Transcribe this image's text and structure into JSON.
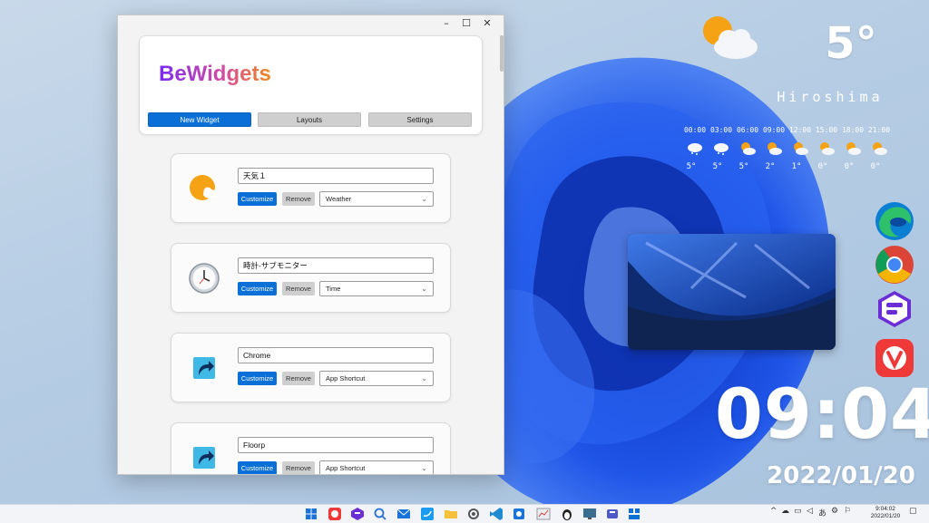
{
  "app": {
    "brand": "BeWidgets",
    "nav": {
      "new_widget": "New Widget",
      "layouts": "Layouts",
      "settings": "Settings"
    },
    "window_controls": {
      "minimize": "–",
      "maximize": "☐",
      "close": "✕"
    },
    "widgets": [
      {
        "name": "天気１",
        "customize": "Customize",
        "remove": "Remove",
        "type": "Weather",
        "icon": "weather-sun-cloud-icon"
      },
      {
        "name": "時計-サブモニター",
        "customize": "Customize",
        "remove": "Remove",
        "type": "Time",
        "icon": "clock-icon"
      },
      {
        "name": "Chrome",
        "customize": "Customize",
        "remove": "Remove",
        "type": "App Shortcut",
        "icon": "shortcut-arrow-icon"
      },
      {
        "name": "Floorp",
        "customize": "Customize",
        "remove": "Remove",
        "type": "App Shortcut",
        "icon": "shortcut-arrow-icon"
      }
    ]
  },
  "weather": {
    "temp": "5°",
    "city": "Hiroshima",
    "forecast": [
      {
        "time": "00:00",
        "temp": "5°",
        "icon": "cloud-snow-icon"
      },
      {
        "time": "03:00",
        "temp": "5°",
        "icon": "cloud-snow-icon"
      },
      {
        "time": "06:00",
        "temp": "5°",
        "icon": "sun-cloud-icon"
      },
      {
        "time": "09:00",
        "temp": "2°",
        "icon": "sun-cloud-icon"
      },
      {
        "time": "12:00",
        "temp": "1°",
        "icon": "sun-cloud-icon"
      },
      {
        "time": "15:00",
        "temp": "0°",
        "icon": "sun-cloud-icon"
      },
      {
        "time": "18:00",
        "temp": "0°",
        "icon": "sun-cloud-icon"
      },
      {
        "time": "21:00",
        "temp": "0°",
        "icon": "sun-cloud-icon"
      }
    ]
  },
  "desktop_apps": [
    "edge-icon",
    "chrome-icon",
    "floorp-icon",
    "vivaldi-icon"
  ],
  "clock": {
    "time": "09:04",
    "date": "2022/01/20"
  },
  "taskbar": {
    "clock_time": "9:04:02",
    "clock_date": "2022/01/20",
    "ime": "あ",
    "tray_icons": [
      "chevron-up-icon",
      "cloud-icon",
      "network-icon",
      "speaker-icon",
      "ime-icon",
      "settings-icon",
      "notification-icon"
    ],
    "pinned": [
      "windows-start-icon",
      "vivaldi-icon",
      "floorp-icon",
      "search-icon",
      "mail-icon",
      "twitter-icon",
      "file-explorer-icon",
      "settings-app-icon",
      "vscode-icon",
      "remote-icon",
      "graph-app-icon",
      "linux-icon",
      "monitor-icon",
      "teams-icon",
      "bewidgets-icon"
    ]
  },
  "colors": {
    "accent": "#0a6fd6",
    "brand_start": "#7b2cf0",
    "brand_end": "#f08a1e"
  }
}
